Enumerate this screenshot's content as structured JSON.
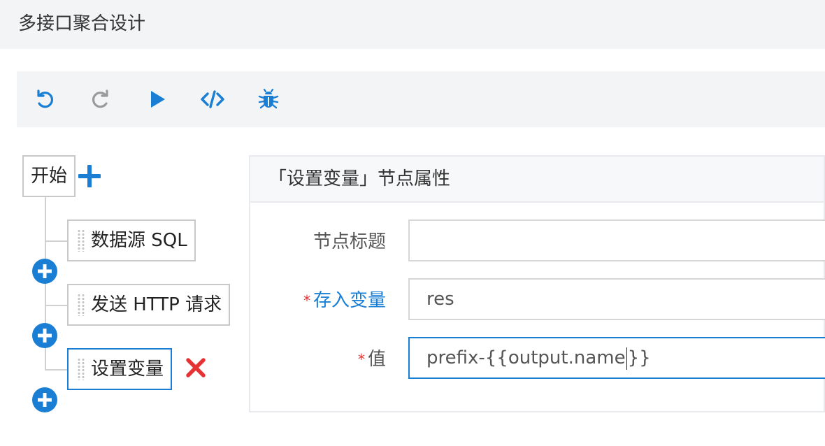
{
  "page": {
    "title": "多接口聚合设计"
  },
  "toolbar": {
    "buttons": [
      {
        "name": "undo-button",
        "icon": "undo-icon",
        "enabled": true
      },
      {
        "name": "redo-button",
        "icon": "redo-icon",
        "enabled": false
      },
      {
        "name": "run-button",
        "icon": "play-icon",
        "enabled": true
      },
      {
        "name": "code-button",
        "icon": "code-icon",
        "enabled": true
      },
      {
        "name": "debug-button",
        "icon": "bug-icon",
        "enabled": true
      }
    ],
    "colors": {
      "active": "#1a7fd4",
      "disabled": "#9a9a9a"
    }
  },
  "tree": {
    "start_label": "开始",
    "nodes": [
      {
        "label": "数据源 SQL",
        "selected": false
      },
      {
        "label": "发送 HTTP 请求",
        "selected": false
      },
      {
        "label": "设置变量",
        "selected": true
      }
    ]
  },
  "panel": {
    "title": "「设置变量」节点属性",
    "fields": {
      "title": {
        "label": "节点标题",
        "value": "",
        "required": false
      },
      "variable": {
        "label": "存入变量",
        "value": "res",
        "required": true
      },
      "value": {
        "label": "值",
        "value_before_caret": "prefix-{{output.name",
        "value_after_caret": "}}",
        "required": true
      }
    },
    "required_mark": "*"
  },
  "colors": {
    "accent": "#1a7fd4",
    "danger": "#e63232",
    "border": "#c8c8c8",
    "header_bg": "#f3f4f5"
  }
}
